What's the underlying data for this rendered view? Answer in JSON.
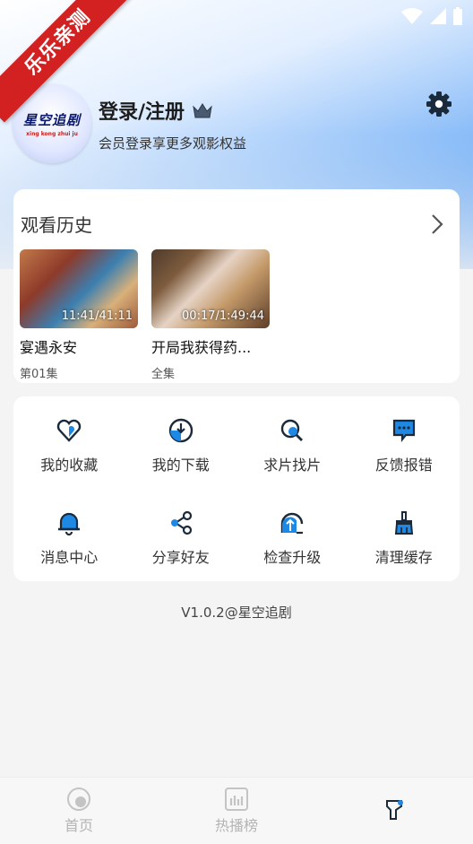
{
  "corner_ribbon": "乐乐亲测",
  "status_icons": [
    "wifi-icon",
    "signal-icon",
    "battery-icon"
  ],
  "avatar": {
    "logo_text": "星空追剧",
    "logo_subtext": "xing kong zhui ju"
  },
  "profile": {
    "login_label": "登录/注册",
    "subtitle": "会员登录享更多观影权益",
    "vip_icon": "crown-icon"
  },
  "settings_icon": "gear-icon",
  "history": {
    "title": "观看历史",
    "items": [
      {
        "name": "宴遇永安",
        "episode": "第01集",
        "progress": "11:41/41:11"
      },
      {
        "name": "开局我获得药...",
        "episode": "全集",
        "progress": "00:17/1:49:44"
      }
    ]
  },
  "menu": [
    {
      "label": "我的收藏",
      "icon": "heart-icon"
    },
    {
      "label": "我的下载",
      "icon": "download-icon"
    },
    {
      "label": "求片找片",
      "icon": "search-icon"
    },
    {
      "label": "反馈报错",
      "icon": "feedback-icon"
    },
    {
      "label": "消息中心",
      "icon": "bell-icon"
    },
    {
      "label": "分享好友",
      "icon": "share-icon"
    },
    {
      "label": "检查升级",
      "icon": "upgrade-icon"
    },
    {
      "label": "清理缓存",
      "icon": "broom-icon"
    }
  ],
  "version": "V1.0.2@星空追剧",
  "tabs": [
    {
      "label": "首页",
      "icon": "home-icon",
      "active": false
    },
    {
      "label": "热播榜",
      "icon": "chart-icon",
      "active": false
    },
    {
      "label": "",
      "icon": "profile-icon",
      "active": true
    }
  ],
  "colors": {
    "accent": "#1e88e5",
    "ribbon": "#d32121",
    "icon_dark": "#1b2a3a"
  }
}
